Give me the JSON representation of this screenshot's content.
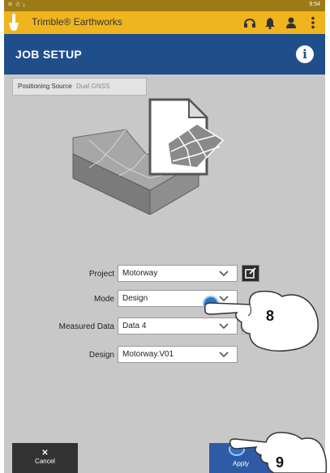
{
  "status_bar": {
    "time": "9:54"
  },
  "app_bar": {
    "title": "Trimble® Earthworks",
    "icons": [
      "shovel-logo-icon",
      "headset-icon",
      "bell-icon",
      "user-icon",
      "kebab-menu-icon"
    ]
  },
  "job_bar": {
    "title": "JOB SETUP",
    "info_icon": "info-icon"
  },
  "positioning": {
    "label": "Positioning Source",
    "value": "Dual GNSS"
  },
  "form": {
    "project": {
      "label": "Project",
      "value": "Motorway"
    },
    "mode": {
      "label": "Mode",
      "value": "Design"
    },
    "measured_data": {
      "label": "Measured Data",
      "value": "Data 4"
    },
    "design": {
      "label": "Design",
      "value": "Motorway.V01"
    }
  },
  "buttons": {
    "cancel": "Cancel",
    "apply": "Apply"
  },
  "annotations": {
    "step_8": "8",
    "step_9": "9"
  },
  "colors": {
    "status_bar": "#9c7a16",
    "app_bar": "#f0b41e",
    "job_bar": "#1f4e8a",
    "apply_button": "#2f5ba6",
    "cancel_button": "#333333",
    "tap_indicator": "#2d73c8"
  }
}
